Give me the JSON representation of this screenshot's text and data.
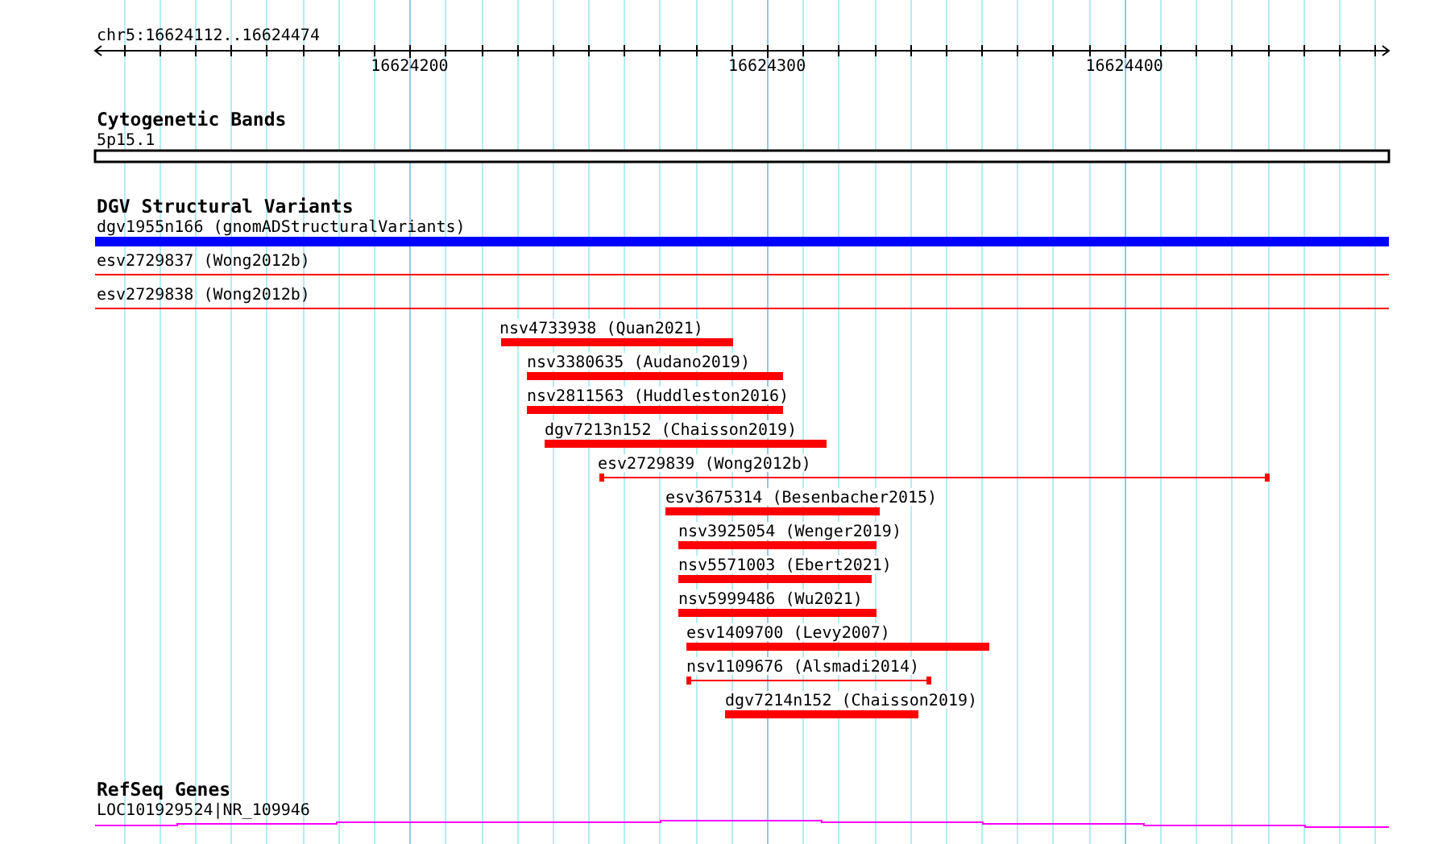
{
  "ruler": {
    "location": "chr5:16624112..16624474",
    "tick_labels": [
      "16624200",
      "16624300",
      "16624400"
    ]
  },
  "tracks": [
    {
      "title": "Cytogenetic Bands",
      "features": [
        {
          "label": "5p15.1",
          "kind": "band",
          "color": "#000000"
        }
      ]
    },
    {
      "title": "DGV Structural Variants",
      "features": [
        {
          "label": "dgv1955n166 (gnomADStructuralVariants)",
          "kind": "bar",
          "color": "#0000ff"
        },
        {
          "label": "esv2729837 (Wong2012b)",
          "kind": "line",
          "color": "#ff0000"
        },
        {
          "label": "esv2729838 (Wong2012b)",
          "kind": "line",
          "color": "#ff0000"
        },
        {
          "label": "nsv4733938 (Quan2021)",
          "kind": "bar",
          "color": "#ff0000"
        },
        {
          "label": "nsv3380635 (Audano2019)",
          "kind": "bar",
          "color": "#ff0000"
        },
        {
          "label": "nsv2811563 (Huddleston2016)",
          "kind": "bar",
          "color": "#ff0000"
        },
        {
          "label": "dgv7213n152 (Chaisson2019)",
          "kind": "bar",
          "color": "#ff0000"
        },
        {
          "label": "esv2729839 (Wong2012b)",
          "kind": "span",
          "color": "#ff0000"
        },
        {
          "label": "esv3675314 (Besenbacher2015)",
          "kind": "bar",
          "color": "#ff0000"
        },
        {
          "label": "nsv3925054 (Wenger2019)",
          "kind": "bar",
          "color": "#ff0000"
        },
        {
          "label": "nsv5571003 (Ebert2021)",
          "kind": "bar",
          "color": "#ff0000"
        },
        {
          "label": "nsv5999486 (Wu2021)",
          "kind": "bar",
          "color": "#ff0000"
        },
        {
          "label": "esv1409700 (Levy2007)",
          "kind": "bar",
          "color": "#ff0000"
        },
        {
          "label": "nsv1109676 (Alsmadi2014)",
          "kind": "span",
          "color": "#ff0000"
        },
        {
          "label": "dgv7214n152 (Chaisson2019)",
          "kind": "bar",
          "color": "#ff0000"
        }
      ]
    },
    {
      "title": "RefSeq Genes",
      "features": [
        {
          "label": "LOC101929524|NR_109946",
          "kind": "gene",
          "color": "#ff00ff"
        }
      ]
    }
  ]
}
